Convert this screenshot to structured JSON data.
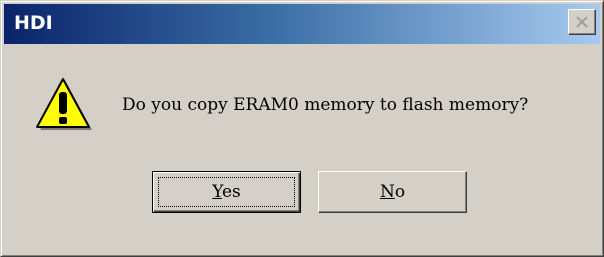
{
  "window": {
    "title": "HDI",
    "close_icon": "close-icon",
    "titlebar_gradient": [
      "#0a246a",
      "#a6caf0"
    ]
  },
  "dialog": {
    "icon": "warning-icon",
    "message": "Do you copy ERAM0 memory to flash memory?"
  },
  "buttons": {
    "yes": {
      "mnemonic": "Y",
      "rest": "es"
    },
    "no": {
      "mnemonic": "N",
      "rest": "o"
    }
  }
}
